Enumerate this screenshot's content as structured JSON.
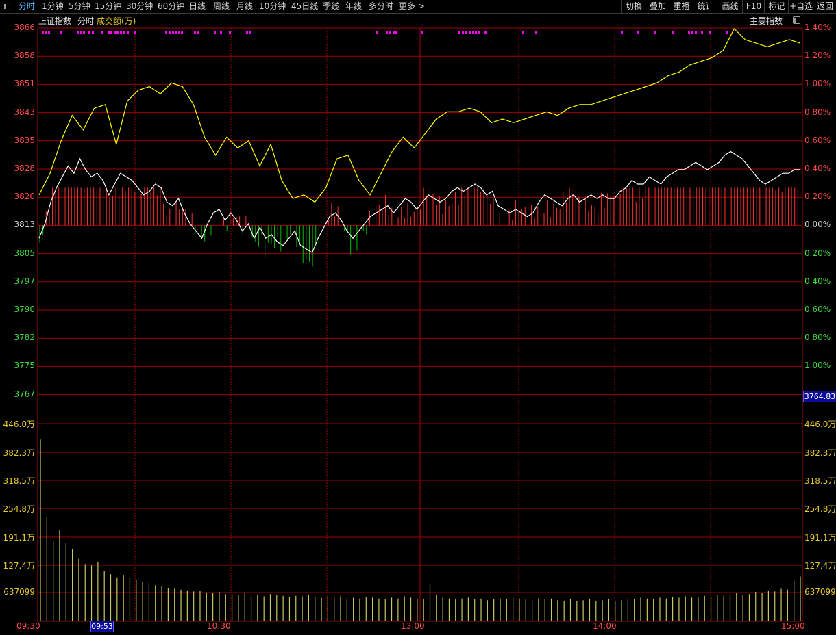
{
  "toolbar": {
    "periods": [
      {
        "label": "分时",
        "active": true
      },
      {
        "label": "1分钟"
      },
      {
        "label": "5分钟"
      },
      {
        "label": "15分钟"
      },
      {
        "label": "30分钟"
      },
      {
        "label": "60分钟"
      },
      {
        "label": "日线"
      },
      {
        "label": "周线"
      },
      {
        "label": "月线"
      },
      {
        "label": "10分钟"
      },
      {
        "label": "45日线"
      },
      {
        "label": "季线"
      },
      {
        "label": "年线"
      },
      {
        "label": "多分时"
      },
      {
        "label": "更多 >"
      }
    ],
    "actions": [
      "切换",
      "叠加",
      "重播",
      "统计",
      "画线",
      "F10",
      "标记",
      "+自选",
      "返回"
    ]
  },
  "header": {
    "index_name": "上证指数",
    "mode": "分时",
    "volume_label": "成交额(万)",
    "main_index_label": "主要指数"
  },
  "price_axis": {
    "ticks": [
      "3866",
      "3858",
      "3851",
      "3843",
      "3835",
      "3828",
      "3820",
      "3813",
      "3805",
      "3797",
      "3790",
      "3782",
      "3775",
      "3767"
    ],
    "last_value": "3764.83"
  },
  "pct_axis": {
    "ticks": [
      "1.40%",
      "1.20%",
      "1.00%",
      "0.80%",
      "0.60%",
      "0.40%",
      "0.20%",
      "0.00%",
      "0.20%",
      "0.40%",
      "0.60%",
      "0.80%",
      "1.00%"
    ]
  },
  "volume_axis": {
    "ticks": [
      "446.0万",
      "382.3万",
      "318.5万",
      "254.8万",
      "191.1万",
      "127.4万",
      "637099"
    ]
  },
  "time_axis": {
    "labels": [
      "09:30",
      "10:30",
      "13:00",
      "14:00",
      "15:00"
    ],
    "cursor": "09:53"
  },
  "colors": {
    "index_line": "#ffffff",
    "avg_line": "#ffff00",
    "up_bar": "#ff3030",
    "down_bar": "#00c000",
    "grid": "#a00000",
    "volume_bar": "#c8c860",
    "signal_dot": "#ff00ff"
  },
  "chart_data": {
    "type": "line",
    "title": "上证指数 分时",
    "prev_close": 3812.6,
    "y_range": [
      3764.83,
      3866.2
    ],
    "x_range": [
      "09:30",
      "15:00"
    ],
    "series": [
      {
        "name": "上证指数",
        "color": "#ffffff",
        "values": [
          3808,
          3812,
          3818,
          3822,
          3825,
          3828,
          3826,
          3830,
          3827,
          3825,
          3826,
          3824,
          3820,
          3823,
          3826,
          3825,
          3824,
          3822,
          3820,
          3821,
          3823,
          3822,
          3818,
          3817,
          3819,
          3815,
          3812,
          3810,
          3808,
          3812,
          3815,
          3816,
          3813,
          3815,
          3813,
          3810,
          3812,
          3808,
          3811,
          3808,
          3809,
          3807,
          3806,
          3808,
          3810,
          3806,
          3805,
          3804,
          3808,
          3811,
          3814,
          3815,
          3813,
          3810,
          3808,
          3810,
          3812,
          3814,
          3815,
          3816,
          3817,
          3815,
          3817,
          3819,
          3818,
          3816,
          3818,
          3820,
          3819,
          3818,
          3819,
          3821,
          3822,
          3821,
          3822,
          3823,
          3822,
          3820,
          3821,
          3817,
          3816,
          3815,
          3816,
          3815,
          3814,
          3815,
          3818,
          3820,
          3819,
          3818,
          3817,
          3819,
          3820,
          3818,
          3819,
          3820,
          3819,
          3820,
          3819,
          3819,
          3821,
          3822,
          3824,
          3823,
          3823,
          3825,
          3824,
          3823,
          3825,
          3826,
          3827,
          3827,
          3828,
          3829,
          3828,
          3827,
          3828,
          3829,
          3831,
          3832,
          3831,
          3830,
          3828,
          3826,
          3824,
          3823,
          3824,
          3825,
          3826,
          3826,
          3827,
          3827
        ]
      },
      {
        "name": "均价",
        "color": "#ffff00",
        "values": [
          3820,
          3826,
          3835,
          3842,
          3838,
          3844,
          3845,
          3834,
          3846,
          3849,
          3850,
          3848,
          3851,
          3850,
          3845,
          3836,
          3831,
          3836,
          3833,
          3835,
          3828,
          3834,
          3824,
          3819,
          3820,
          3818,
          3822,
          3830,
          3831,
          3824,
          3820,
          3826,
          3832,
          3836,
          3833,
          3837,
          3841,
          3843,
          3843,
          3844,
          3843,
          3840,
          3841,
          3840,
          3841,
          3842,
          3843,
          3842,
          3844,
          3845,
          3845,
          3846,
          3847,
          3848,
          3849,
          3850,
          3851,
          3853,
          3854,
          3856,
          3857,
          3858,
          3860,
          3866,
          3863,
          3862,
          3861,
          3862,
          3863,
          3862
        ]
      }
    ],
    "volume_bars": {
      "unit": "万",
      "values": [
        410,
        235,
        180,
        205,
        175,
        162,
        140,
        128,
        125,
        132,
        112,
        105,
        98,
        102,
        96,
        92,
        88,
        85,
        80,
        78,
        74,
        72,
        70,
        68,
        66,
        68,
        64,
        62,
        65,
        60,
        60,
        58,
        62,
        56,
        58,
        55,
        60,
        58,
        56,
        54,
        56,
        55,
        58,
        54,
        52,
        55,
        52,
        55,
        50,
        52,
        50,
        54,
        52,
        50,
        48,
        52,
        50,
        55,
        52,
        50,
        48,
        82,
        58,
        52,
        50,
        48,
        50,
        52,
        48,
        50,
        46,
        48,
        50,
        48,
        52,
        50,
        48,
        46,
        50,
        48,
        50,
        46,
        44,
        48,
        45,
        46,
        48,
        44,
        46,
        48,
        45,
        46,
        50,
        48,
        52,
        50,
        48,
        52,
        50,
        54,
        52,
        55,
        52,
        54,
        56,
        55,
        58,
        56,
        60,
        62,
        58,
        60,
        65,
        62,
        68,
        66,
        72,
        70,
        90,
        100
      ]
    }
  }
}
